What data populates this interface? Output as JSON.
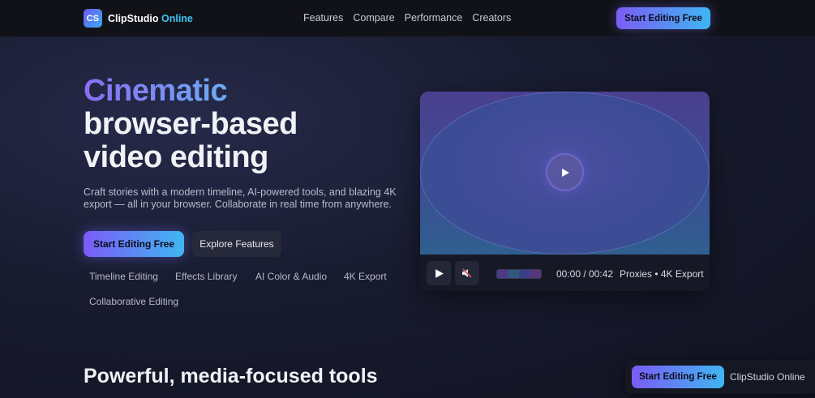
{
  "nav": {
    "logo_text": "CS",
    "brand_name": "ClipStudio",
    "brand_accent": "Online",
    "links": [
      "Features",
      "Compare",
      "Performance",
      "Creators"
    ],
    "cta": "Start Editing Free"
  },
  "hero": {
    "title_highlight": "Cinematic",
    "title_line2": "browser-based",
    "title_line3": "video editing",
    "subtitle": "Craft stories with a modern timeline, AI-powered tools, and blazing 4K export — all in your browser. Collaborate in real time from anywhere.",
    "primary_cta": "Start Editing Free",
    "secondary_cta": "Explore Features",
    "tags": [
      "Timeline Editing",
      "Effects Library",
      "AI Color & Audio",
      "4K Export",
      "Collaborative Editing"
    ]
  },
  "player": {
    "time": "00:00 / 00:42",
    "meta": "Proxies • 4K Export",
    "play_icon": "play-icon",
    "mute_icon": "muted-speaker-icon"
  },
  "section": {
    "title": "Powerful, media-focused tools"
  },
  "floating": {
    "cta": "Start Editing Free",
    "label": "ClipStudio Online"
  },
  "colors": {
    "accent_start": "#7b5cf6",
    "accent_end": "#3fb6f2",
    "background": "#181b2e"
  }
}
